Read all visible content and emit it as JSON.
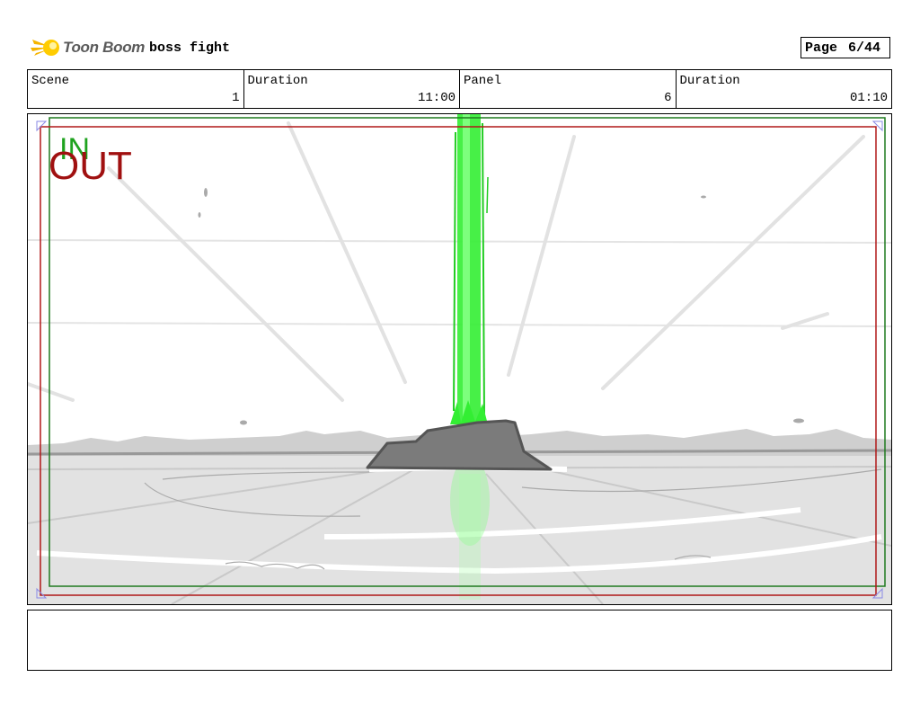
{
  "header": {
    "logo_text": "Toon Boom",
    "project_title": "boss fight",
    "page_label": "Page",
    "page_value": "6/44"
  },
  "info": {
    "scene_label": "Scene",
    "scene_value": "1",
    "scene_duration_label": "Duration",
    "scene_duration_value": "11:00",
    "panel_label": "Panel",
    "panel_value": "6",
    "panel_duration_label": "Duration",
    "panel_duration_value": "01:10"
  },
  "panel": {
    "in_label": "IN",
    "out_label": "OUT",
    "in_color": "#1fa31f",
    "out_color": "#a01010",
    "beam_color": "#33ee33"
  },
  "notes": {
    "text": ""
  }
}
